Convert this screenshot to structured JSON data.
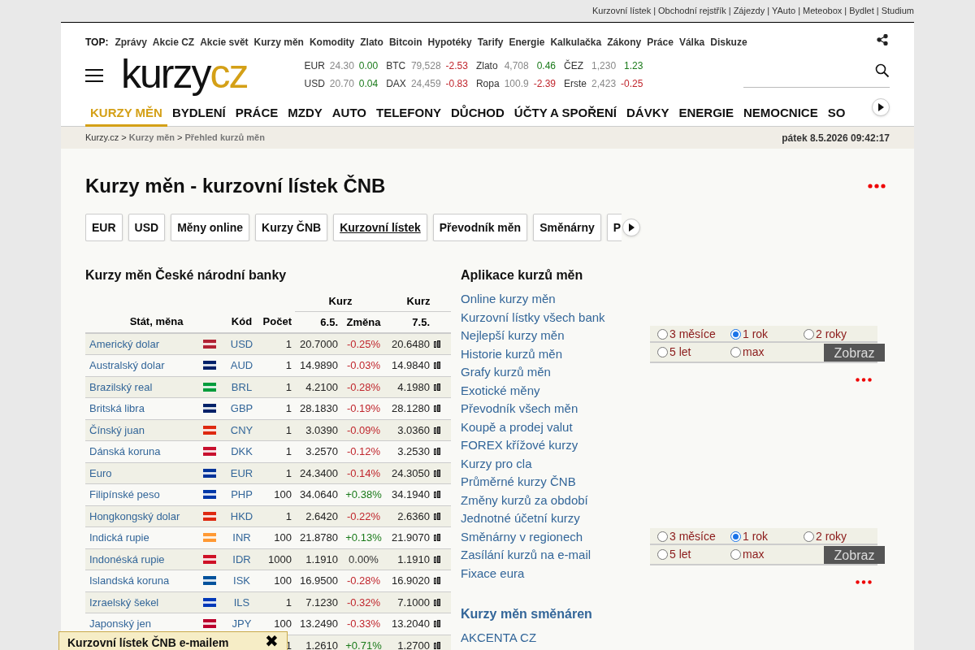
{
  "top_links": [
    "Kurzovní lístek",
    "Obchodní rejstřík",
    "Zájezdy",
    "YAuto",
    "Meteobox",
    "Bydlet",
    "Studium"
  ],
  "top_links_separator": "|",
  "top_label": "TOP:",
  "top_menu": [
    "Zprávy",
    "Akcie CZ",
    "Akcie svět",
    "Kurzy měn",
    "Komodity",
    "Zlato",
    "Bitcoin",
    "Hypotéky",
    "Tarify",
    "Energie",
    "Kalkulačka",
    "Zákony",
    "Práce",
    "Válka",
    "Diskuze"
  ],
  "logo": {
    "part_1": "kurzy",
    "part_2": "cz"
  },
  "ticker": [
    {
      "name": "EUR",
      "value": "24.30",
      "change": "0.00",
      "color": "#1a7a1a"
    },
    {
      "name": "BTC",
      "value": "79,528",
      "change": "-2.53",
      "color": "#c0262d"
    },
    {
      "name": "Zlato",
      "value": "4,708",
      "change": "0.46",
      "color": "#1a7a1a"
    },
    {
      "name": "ČEZ",
      "value": "1,230",
      "change": "1.23",
      "color": "#1a7a1a"
    },
    {
      "name": "USD",
      "value": "20.70",
      "change": "0.04",
      "color": "#1a7a1a"
    },
    {
      "name": "DAX",
      "value": "24,459",
      "change": "-0.83",
      "color": "#c0262d"
    },
    {
      "name": "Ropa",
      "value": "100.9",
      "change": "-2.39",
      "color": "#c0262d"
    },
    {
      "name": "Erste",
      "value": "2,423",
      "change": "-0.25",
      "color": "#c0262d"
    }
  ],
  "main_nav": [
    {
      "label": "KURZY MĚN",
      "selected": true
    },
    {
      "label": "BYDLENÍ",
      "selected": false
    },
    {
      "label": "PRÁCE",
      "selected": false
    },
    {
      "label": "MZDY",
      "selected": false
    },
    {
      "label": "AUTO",
      "selected": false
    },
    {
      "label": "TELEFONY",
      "selected": false
    },
    {
      "label": "DŮCHOD",
      "selected": false
    },
    {
      "label": "ÚČTY A SPOŘENÍ",
      "selected": false
    },
    {
      "label": "DÁVKY",
      "selected": false
    },
    {
      "label": "ENERGIE",
      "selected": false
    },
    {
      "label": "NEMOCNICE",
      "selected": false
    },
    {
      "label": "SO",
      "selected": false
    }
  ],
  "breadcrumb": [
    "Kurzy.cz",
    "Kurzy měn",
    "Přehled kurzů měn"
  ],
  "breadcrumb_separator": ">",
  "datetime": "pátek 8.5.2026 09:42:17",
  "title": "Kurzy měn - kurzovní lístek ČNB",
  "tabs": [
    {
      "label": "EUR",
      "selected": false
    },
    {
      "label": "USD",
      "selected": false
    },
    {
      "label": "Měny online",
      "selected": false
    },
    {
      "label": "Kurzy ČNB",
      "selected": false
    },
    {
      "label": "Kurzovní lístek",
      "selected": true
    },
    {
      "label": "Převodník měn",
      "selected": false
    },
    {
      "label": "Směnárny",
      "selected": false
    },
    {
      "label": "P",
      "selected": false
    }
  ],
  "table": {
    "title": "Kurzy měn České národní banky",
    "group_headers": [
      "Kurz",
      "Kurz"
    ],
    "columns": [
      "Stát, měna",
      "Kód",
      "Počet",
      "6.5.",
      "Změna",
      "7.5."
    ],
    "rows": [
      {
        "name": "Americký dolar",
        "flag": {
          "color": "#b22234"
        },
        "code": "USD",
        "count": "1",
        "rate_1": "20.7000",
        "change": "-0.25%",
        "color": "#c0262d",
        "rate_2": "20.6480"
      },
      {
        "name": "Australský dolar",
        "flag": {
          "color": "#012169"
        },
        "code": "AUD",
        "count": "1",
        "rate_1": "14.9890",
        "change": "-0.03%",
        "color": "#c0262d",
        "rate_2": "14.9840"
      },
      {
        "name": "Brazilský real",
        "flag": {
          "color": "#009c3b"
        },
        "code": "BRL",
        "count": "1",
        "rate_1": "4.2100",
        "change": "-0.28%",
        "color": "#c0262d",
        "rate_2": "4.1980"
      },
      {
        "name": "Britská libra",
        "flag": {
          "color": "#012168"
        },
        "code": "GBP",
        "count": "1",
        "rate_1": "28.1830",
        "change": "-0.19%",
        "color": "#c0262d",
        "rate_2": "28.1280"
      },
      {
        "name": "Čínský juan",
        "flag": {
          "color": "#de2910"
        },
        "code": "CNY",
        "count": "1",
        "rate_1": "3.0390",
        "change": "-0.09%",
        "color": "#c0262d",
        "rate_2": "3.0360"
      },
      {
        "name": "Dánská koruna",
        "flag": {
          "color": "#c8102e"
        },
        "code": "DKK",
        "count": "1",
        "rate_1": "3.2570",
        "change": "-0.12%",
        "color": "#c0262d",
        "rate_2": "3.2530"
      },
      {
        "name": "Euro",
        "flag": {
          "color": "#003399"
        },
        "code": "EUR",
        "count": "1",
        "rate_1": "24.3400",
        "change": "-0.14%",
        "color": "#c0262d",
        "rate_2": "24.3050"
      },
      {
        "name": "Filipínské peso",
        "flag": {
          "color": "#0038a8"
        },
        "code": "PHP",
        "count": "100",
        "rate_1": "34.0640",
        "change": "+0.38%",
        "color": "#1a7a1a",
        "rate_2": "34.1940"
      },
      {
        "name": "Hongkongský dolar",
        "flag": {
          "color": "#de2911"
        },
        "code": "HKD",
        "count": "1",
        "rate_1": "2.6420",
        "change": "-0.22%",
        "color": "#c0262d",
        "rate_2": "2.6360"
      },
      {
        "name": "Indická rupie",
        "flag": {
          "color": "#ff9933"
        },
        "code": "INR",
        "count": "100",
        "rate_1": "21.8780",
        "change": "+0.13%",
        "color": "#1a7a1a",
        "rate_2": "21.9070"
      },
      {
        "name": "Indonéská rupie",
        "flag": {
          "color": "#ce1126"
        },
        "code": "IDR",
        "count": "1000",
        "rate_1": "1.1910",
        "change": "0.00%",
        "color": "#333333",
        "rate_2": "1.1910"
      },
      {
        "name": "Islandská koruna",
        "flag": {
          "color": "#02529c"
        },
        "code": "ISK",
        "count": "100",
        "rate_1": "16.9500",
        "change": "-0.28%",
        "color": "#c0262d",
        "rate_2": "16.9020"
      },
      {
        "name": "Izraelský šekel",
        "flag": {
          "color": "#0038b8"
        },
        "code": "ILS",
        "count": "1",
        "rate_1": "7.1230",
        "change": "-0.32%",
        "color": "#c0262d",
        "rate_2": "7.1000"
      },
      {
        "name": "Japonský jen",
        "flag": {
          "color": "#bc002d"
        },
        "code": "JPY",
        "count": "100",
        "rate_1": "13.2490",
        "change": "-0.33%",
        "color": "#c0262d",
        "rate_2": "13.2040"
      },
      {
        "count": "1",
        "rate_1": "1.2610",
        "change": "+0.71%",
        "color": "#1a7a1a",
        "rate_2": "1.2700"
      }
    ]
  },
  "apps": {
    "title": "Aplikace kurzů měn",
    "links": [
      "Online kurzy měn",
      "Kurzovní lístky všech bank",
      "Nejlepší kurzy měn",
      "Historie kurzů měn",
      "Grafy kurzů měn",
      "Exotické měny",
      "Převodník všech měn",
      "Koupě a prodej valut",
      "FOREX křížové kurzy",
      "Kurzy pro cla",
      "Průměrné kurzy ČNB",
      "Změny kurzů za období",
      "Jednotné účetní kurzy",
      "Směnárny v regionech",
      "Zasílání kurzů na e-mail",
      "Fixace eura"
    ]
  },
  "exchanges": {
    "title": "Kurzy měn směnáren",
    "links": [
      "AKCENTA CZ"
    ]
  },
  "period_widgets": [
    {
      "options": [
        {
          "label": "3 měsíce",
          "selected": false
        },
        {
          "label": "1 rok",
          "selected": true
        },
        {
          "label": "2 roky",
          "selected": false
        },
        {
          "label": "5 let",
          "selected": false
        },
        {
          "label": "max",
          "selected": false
        }
      ],
      "button": "Zobraz"
    },
    {
      "options": [
        {
          "label": "3 měsíce",
          "selected": false
        },
        {
          "label": "1 rok",
          "selected": true
        },
        {
          "label": "2 roky",
          "selected": false
        },
        {
          "label": "5 let",
          "selected": false
        },
        {
          "label": "max",
          "selected": false
        }
      ],
      "button": "Zobraz"
    }
  ],
  "popup": {
    "title": "Kurzovní lístek ČNB e-mailem",
    "close": "✖"
  }
}
